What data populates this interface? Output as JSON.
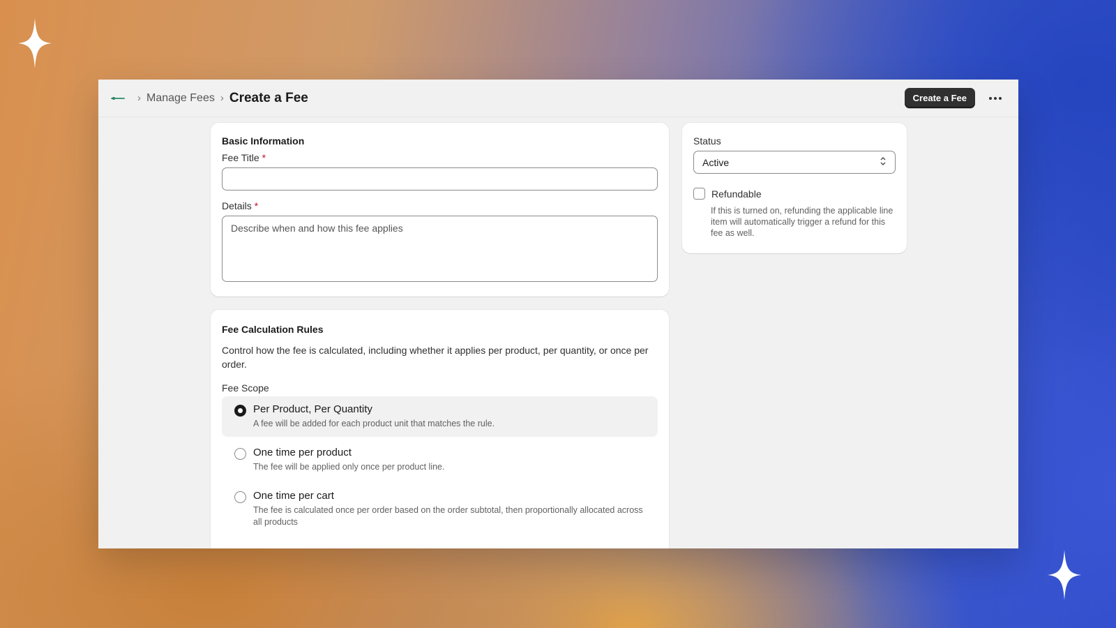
{
  "header": {
    "breadcrumb_parent": "Manage Fees",
    "page_title": "Create a Fee",
    "primary_action": "Create a Fee",
    "more_icon": "ellipsis-icon"
  },
  "basic_info": {
    "title": "Basic Information",
    "fee_title_label": "Fee Title",
    "details_label": "Details",
    "details_placeholder": "Describe when and how this fee applies",
    "required_mark": "*"
  },
  "rules": {
    "title": "Fee Calculation Rules",
    "description": "Control how the fee is calculated, including whether it applies per product, per quantity, or once per order.",
    "scope_label": "Fee Scope",
    "options": [
      {
        "title": "Per Product, Per Quantity",
        "desc": "A fee will be added for each product unit that matches the rule.",
        "selected": true
      },
      {
        "title": "One time per product",
        "desc": "The fee will be applied only once per product line.",
        "selected": false
      },
      {
        "title": "One time per cart",
        "desc": "The fee is calculated once per order based on the order subtotal, then proportionally allocated across all products",
        "selected": false
      }
    ]
  },
  "status": {
    "label": "Status",
    "value": "Active",
    "refundable_label": "Refundable",
    "refundable_help": "If this is turned on, refunding the applicable line item will automatically trigger a refund for this fee as well."
  },
  "colors": {
    "primary_button": "#303030",
    "required": "#c0112a",
    "selected_bg": "#f1f1f1"
  }
}
